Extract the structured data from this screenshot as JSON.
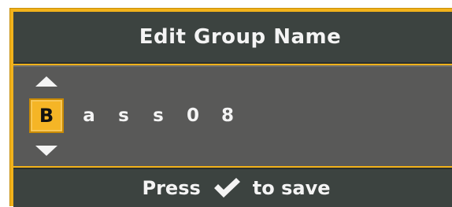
{
  "dialog": {
    "title": "Edit Group Name"
  },
  "editor": {
    "characters": [
      "B",
      "a",
      "s",
      "s",
      "0",
      "8"
    ],
    "selected_index": 0,
    "up_icon": "arrow-up-icon",
    "down_icon": "arrow-down-icon"
  },
  "footer": {
    "prefix": "Press",
    "icon": "checkmark-icon",
    "suffix": "to save"
  },
  "colors": {
    "accent": "#f2b21b",
    "header_bg": "#3c4340",
    "editor_bg": "#595958",
    "text": "#f4f4f4"
  }
}
